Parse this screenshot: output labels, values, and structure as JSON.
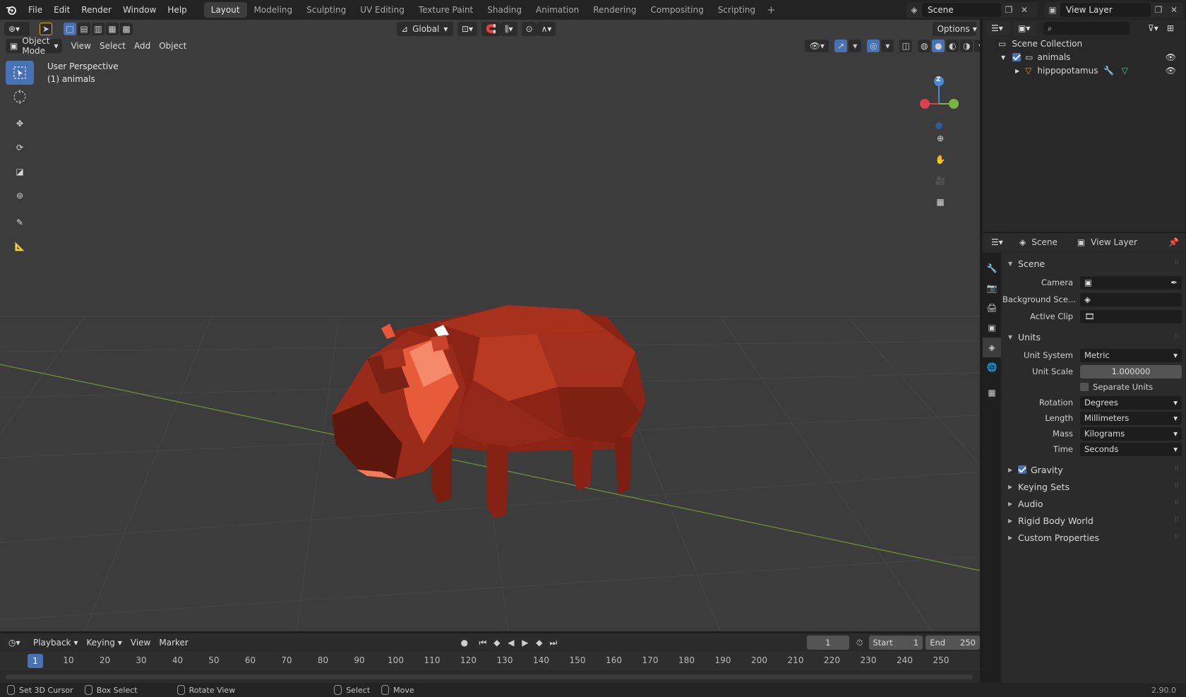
{
  "topbar": {
    "menus": [
      "File",
      "Edit",
      "Render",
      "Window",
      "Help"
    ],
    "workspaces": [
      "Layout",
      "Modeling",
      "Sculpting",
      "UV Editing",
      "Texture Paint",
      "Shading",
      "Animation",
      "Rendering",
      "Compositing",
      "Scripting"
    ],
    "active_workspace": "Layout",
    "add_tab": "+",
    "scene": "Scene",
    "view_layer": "View Layer"
  },
  "viewport": {
    "orientation": "Global",
    "options": "Options",
    "mode": "Object Mode",
    "menus": [
      "View",
      "Select",
      "Add",
      "Object"
    ],
    "info_line1": "User Perspective",
    "info_line2": "(1) animals",
    "gizmo_z": "Z"
  },
  "timeline": {
    "menus": [
      "Playback",
      "Keying",
      "View",
      "Marker"
    ],
    "current_frame": "1",
    "start_label": "Start",
    "start_value": "1",
    "end_label": "End",
    "end_value": "250",
    "ticks": [
      "10",
      "20",
      "30",
      "40",
      "50",
      "60",
      "70",
      "80",
      "90",
      "100",
      "110",
      "120",
      "130",
      "140",
      "150",
      "160",
      "170",
      "180",
      "190",
      "200",
      "210",
      "220",
      "230",
      "240",
      "250"
    ],
    "frame_marker": "1"
  },
  "statusbar": {
    "items": [
      "Set 3D Cursor",
      "Box Select",
      "Rotate View",
      "Select",
      "Move"
    ],
    "version": "2.90.0"
  },
  "outliner": {
    "root": "Scene Collection",
    "collection": "animals",
    "object": "hippopotamus"
  },
  "properties": {
    "header_scene": "Scene",
    "header_view_layer": "View Layer",
    "scene_section": "Scene",
    "camera_label": "Camera",
    "background_label": "Background Sce...",
    "active_clip_label": "Active Clip",
    "units_section": "Units",
    "unit_system_label": "Unit System",
    "unit_system_value": "Metric",
    "unit_scale_label": "Unit Scale",
    "unit_scale_value": "1.000000",
    "separate_units": "Separate Units",
    "rotation_label": "Rotation",
    "rotation_value": "Degrees",
    "length_label": "Length",
    "length_value": "Millimeters",
    "mass_label": "Mass",
    "mass_value": "Kilograms",
    "time_label": "Time",
    "time_value": "Seconds",
    "gravity": "Gravity",
    "keying_sets": "Keying Sets",
    "audio": "Audio",
    "rigid_body_world": "Rigid Body World",
    "custom_properties": "Custom Properties"
  },
  "colors": {
    "accent": "#4772b3",
    "viewport_bg": "#3c3c3c",
    "model": "#b8321f"
  }
}
